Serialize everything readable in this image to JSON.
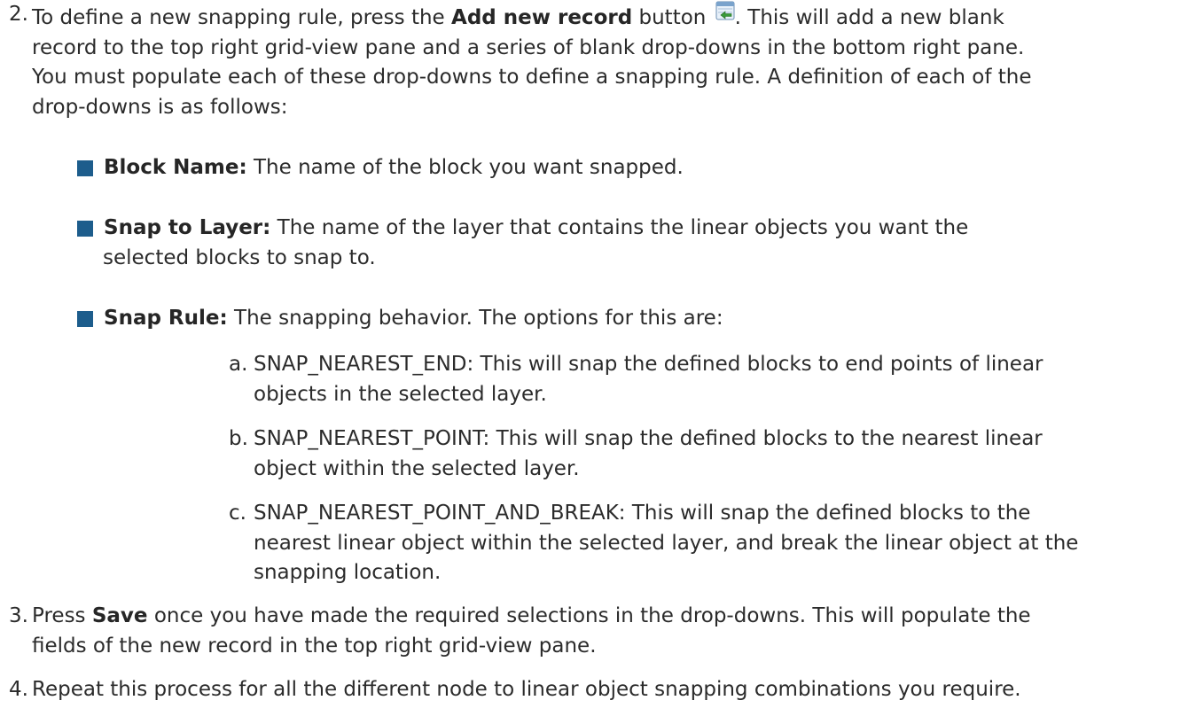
{
  "step2": {
    "number": "2.",
    "intro": "To define a new snapping rule, press the ",
    "button_name": "Add new record",
    "after_button": " button ",
    "icon": "add-record-icon",
    "line1_end": ". This will add a new blank",
    "line2": "record to the top right grid-view pane and a series of blank drop-downs in the bottom right pane.",
    "line3": "You must populate each of these drop-downs to define a snapping rule. A definition of each of the",
    "line4": "drop-downs is as follows:"
  },
  "bullets": [
    {
      "term": "Block Name:",
      "line1": " The name of the block you want snapped.",
      "line2": ""
    },
    {
      "term": "Snap to Layer:",
      "line1": " The name of the layer that contains the linear objects you want the",
      "line2": "selected blocks to snap to."
    },
    {
      "term": "Snap Rule:",
      "line1": " The snapping behavior. The options for this are:",
      "line2": ""
    }
  ],
  "options": [
    {
      "letter": "a.",
      "line1": "SNAP_NEAREST_END: This will snap the defined blocks to end points of linear",
      "line2": "objects in the selected layer.",
      "line3": ""
    },
    {
      "letter": "b.",
      "line1": "SNAP_NEAREST_POINT: This will snap the defined blocks to the nearest linear",
      "line2": "object within the selected layer.",
      "line3": ""
    },
    {
      "letter": "c.",
      "line1": "SNAP_NEAREST_POINT_AND_BREAK: This will snap the defined blocks to the",
      "line2": "nearest linear object within the selected layer, and break the linear object at the",
      "line3": "snapping location."
    }
  ],
  "step3": {
    "number": "3.",
    "intro": "Press ",
    "button_name": "Save",
    "line1_end": " once you have made the required selections in the drop-downs. This will populate the",
    "line2": "fields of the new record in the top right grid-view pane."
  },
  "step4": {
    "number": "4.",
    "line1": "Repeat this process for all the different node to linear object snapping combinations you require."
  },
  "colors": {
    "text": "#2b2b2b",
    "bullet": "#1d5d8c"
  }
}
